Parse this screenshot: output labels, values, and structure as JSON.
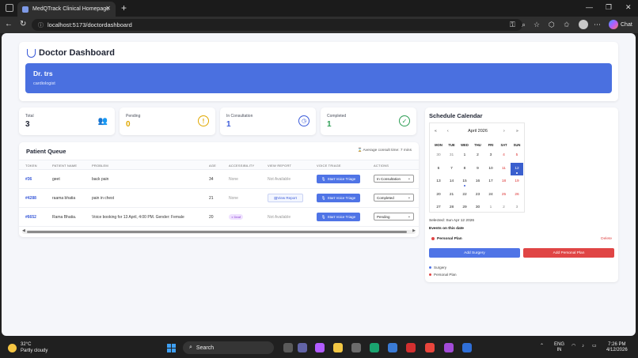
{
  "browser": {
    "tab_title": "MedQTrack Clinical Homepage",
    "tab_close": "✕",
    "new_tab": "+",
    "url": "localhost:5173/doctordashboard",
    "chat_label": "Chat"
  },
  "header": {
    "title": "Doctor Dashboard",
    "doctor_name": "Dr. trs",
    "specialty": "cardiologist"
  },
  "stats": {
    "total": {
      "label": "Total",
      "value": "3",
      "color": "#1f2433"
    },
    "pending": {
      "label": "Pending",
      "value": "0",
      "color": "#e0a800"
    },
    "in_consultation": {
      "label": "In Consultation",
      "value": "1",
      "color": "#3b5bd9"
    },
    "completed": {
      "label": "Completed",
      "value": "1",
      "color": "#2e9e55"
    }
  },
  "queue": {
    "title": "Patient Queue",
    "avg_text": "Average consult time: 7 mins",
    "columns": [
      "TOKEN",
      "PATIENT NAME",
      "PROBLEM",
      "AGE",
      "ACCESSIBILITY",
      "VIEW REPORT",
      "VOICE TRIAGE",
      "ACTIONS"
    ],
    "triage_label": "Start Voice Triage",
    "rows": [
      {
        "token": "#36",
        "name": "geet",
        "problem": "back pain",
        "age": "34",
        "accessibility": "None",
        "report": "Not Available",
        "action": "In Consultation"
      },
      {
        "token": "#4288",
        "name": "raama bhatia",
        "problem": "pain in chest",
        "age": "21",
        "accessibility": "None",
        "report": "View Report",
        "action": "Completed"
      },
      {
        "token": "#6652",
        "name": "Rama Bhatia.",
        "problem": "Voice booking for 13 April, 4:00 PM. Gender: Female",
        "age": "20",
        "accessibility": "Deaf",
        "report": "Not Available",
        "action": "Pending"
      }
    ]
  },
  "calendar": {
    "title": "Schedule Calendar",
    "month": "April 2026",
    "nav": {
      "first": "«",
      "prev": "‹",
      "next": "›",
      "last": "»"
    },
    "weekdays": [
      "MON",
      "TUE",
      "WED",
      "THU",
      "FRI",
      "SAT",
      "SUN"
    ],
    "weeks": [
      [
        "30",
        "31",
        "1",
        "2",
        "3",
        "4",
        "5"
      ],
      [
        "6",
        "7",
        "8",
        "9",
        "10",
        "11",
        "12"
      ],
      [
        "13",
        "14",
        "15",
        "16",
        "17",
        "18",
        "19"
      ],
      [
        "20",
        "21",
        "22",
        "23",
        "24",
        "25",
        "26"
      ],
      [
        "27",
        "28",
        "29",
        "30",
        "1",
        "2",
        "3"
      ]
    ],
    "selected_text": "Selected: Sun Apr 12 2026",
    "events_title": "Events on this date",
    "event": {
      "name": "Personal Plan",
      "delete": "Delete"
    },
    "add_surgery": "Add Surgery",
    "add_personal": "Add Personal Plan",
    "legend": [
      "Surgery",
      "Personal Plan"
    ],
    "colors": {
      "surgery": "#4f74e6",
      "personal": "#e04545",
      "selected": "#3a5fce"
    }
  },
  "taskbar": {
    "temp": "32°C",
    "weather": "Partly cloudy",
    "search": "Search",
    "lang1": "ENG",
    "lang2": "IN",
    "time": "7:26 PM",
    "date": "4/12/2026"
  }
}
